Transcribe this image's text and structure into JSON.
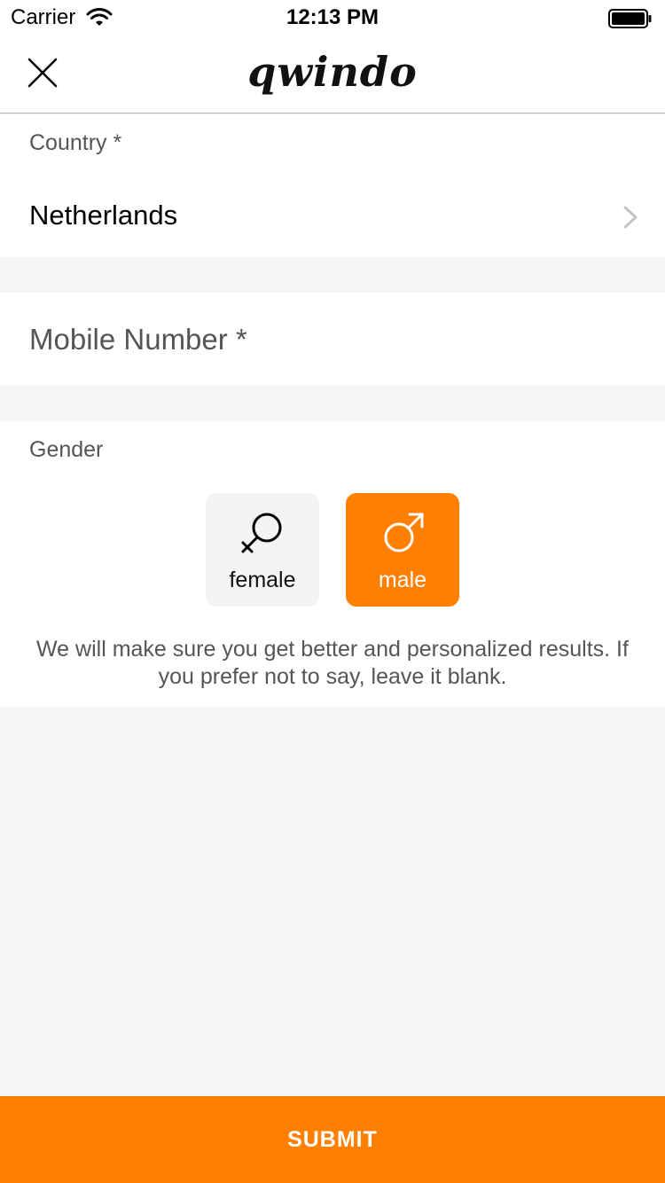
{
  "status_bar": {
    "carrier": "Carrier",
    "time": "12:13 PM",
    "wifi_icon": "wifi-icon",
    "battery_icon": "battery-full-icon"
  },
  "nav": {
    "close_icon": "close-icon",
    "logo": "qwindo"
  },
  "country": {
    "label": "Country *",
    "value": "Netherlands",
    "chevron_icon": "chevron-right-icon"
  },
  "mobile": {
    "placeholder": "Mobile Number *",
    "value": ""
  },
  "gender": {
    "label": "Gender",
    "options": [
      {
        "label": "female",
        "icon": "female-symbol-icon",
        "selected": false
      },
      {
        "label": "male",
        "icon": "male-symbol-icon",
        "selected": true
      }
    ],
    "note": "We will make sure you get better and personalized results. If you prefer not to say, leave it blank."
  },
  "submit": {
    "label": "SUBMIT"
  },
  "colors": {
    "accent": "#ff7f00",
    "background": "#f4f5f7",
    "surface": "#ffffff",
    "muted_text": "#555555"
  }
}
